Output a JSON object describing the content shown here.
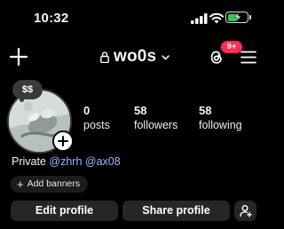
{
  "status_bar": {
    "time": "10:32",
    "battery_level": 0.55
  },
  "header": {
    "username": "wo0s",
    "notification_badge": "9+"
  },
  "profile": {
    "note": "$$",
    "stats": [
      {
        "value": "0",
        "label": "posts"
      },
      {
        "value": "58",
        "label": "followers"
      },
      {
        "value": "58",
        "label": "following"
      }
    ],
    "bio": {
      "prefix": "Private ",
      "mention_1": "@zhrh",
      "mention_2": "@ax08"
    },
    "add_banners_label": "Add banners"
  },
  "actions": {
    "edit_label": "Edit profile",
    "share_label": "Share profile"
  },
  "colors": {
    "badge": "#ff2d55",
    "mention": "#9fb4ff",
    "battery": "#34c759",
    "button_bg": "#262628"
  }
}
